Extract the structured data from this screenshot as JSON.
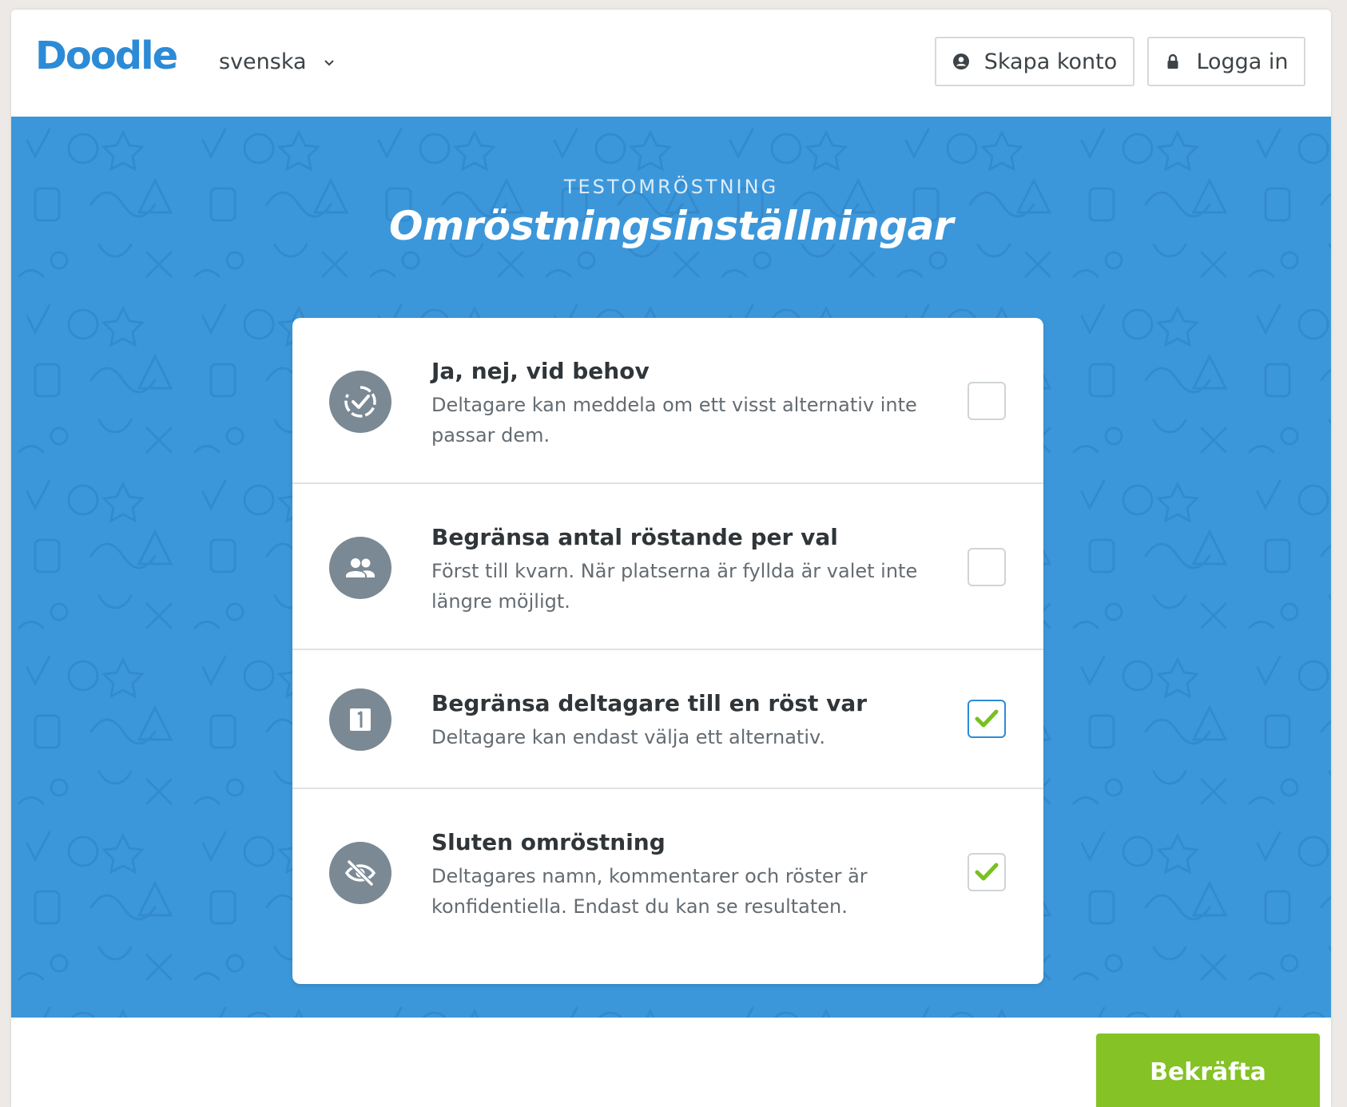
{
  "header": {
    "logo": "Doodle",
    "language": "svenska",
    "create_account": "Skapa konto",
    "login": "Logga in"
  },
  "hero": {
    "eyebrow": "TESTOMRÖSTNING",
    "title": "Omröstningsinställningar"
  },
  "settings": [
    {
      "title": "Ja, nej, vid behov",
      "description": "Deltagare kan meddela om ett visst alternativ inte passar dem.",
      "icon": "check-circle-icon",
      "checked": false
    },
    {
      "title": "Begränsa antal röstande per val",
      "description": "Först till kvarn. När platserna är fyllda är valet inte längre möjligt.",
      "icon": "people-icon",
      "checked": false
    },
    {
      "title": "Begränsa deltagare till en röst var",
      "description": "Deltagare kan endast välja ett alternativ.",
      "icon": "number-one-icon",
      "checked": true
    },
    {
      "title": "Sluten omröstning",
      "description": "Deltagares namn, kommentarer och röster är konfidentiella. Endast du kan se resultaten.",
      "icon": "eye-off-icon",
      "checked": true
    }
  ],
  "footer": {
    "confirm": "Bekräfta"
  },
  "colors": {
    "brand_blue": "#2c8bd7",
    "hero_blue": "#3c97da",
    "confirm_green": "#84c225",
    "check_green": "#79c021",
    "icon_grey": "#7a8994"
  }
}
